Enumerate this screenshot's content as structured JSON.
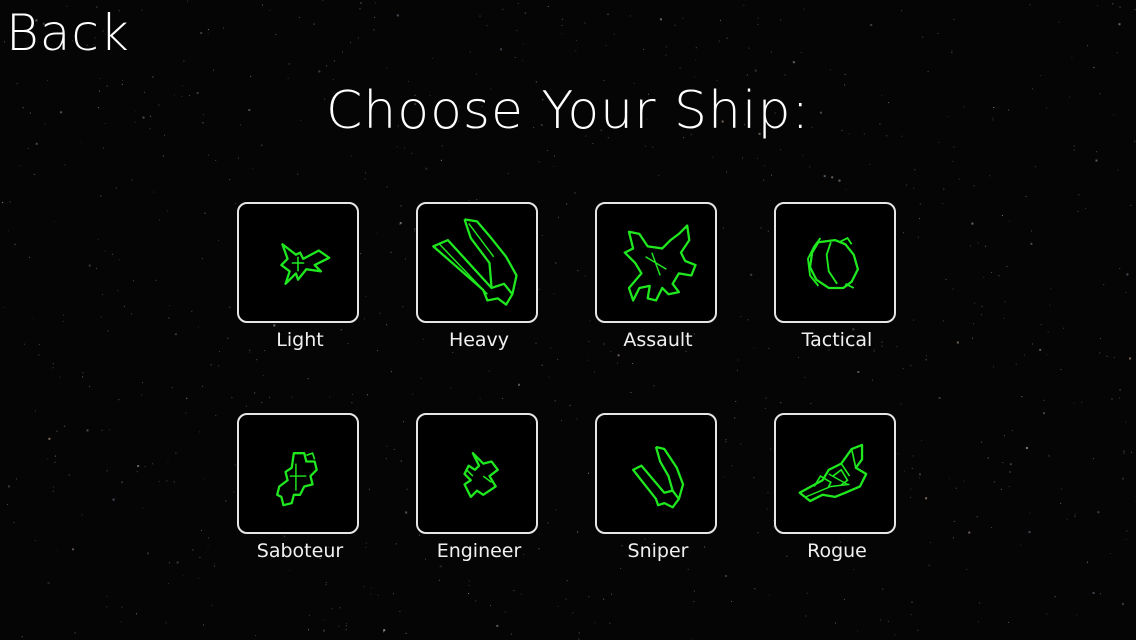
{
  "back_label": "Back",
  "title": "Choose Your Ship:",
  "accent_color": "#1fe81f",
  "ships": [
    {
      "label": "Light",
      "icon": "light-ship-icon"
    },
    {
      "label": "Heavy",
      "icon": "heavy-ship-icon"
    },
    {
      "label": "Assault",
      "icon": "assault-ship-icon"
    },
    {
      "label": "Tactical",
      "icon": "tactical-ship-icon"
    },
    {
      "label": "Saboteur",
      "icon": "saboteur-ship-icon"
    },
    {
      "label": "Engineer",
      "icon": "engineer-ship-icon"
    },
    {
      "label": "Sniper",
      "icon": "sniper-ship-icon"
    },
    {
      "label": "Rogue",
      "icon": "rogue-ship-icon"
    }
  ]
}
